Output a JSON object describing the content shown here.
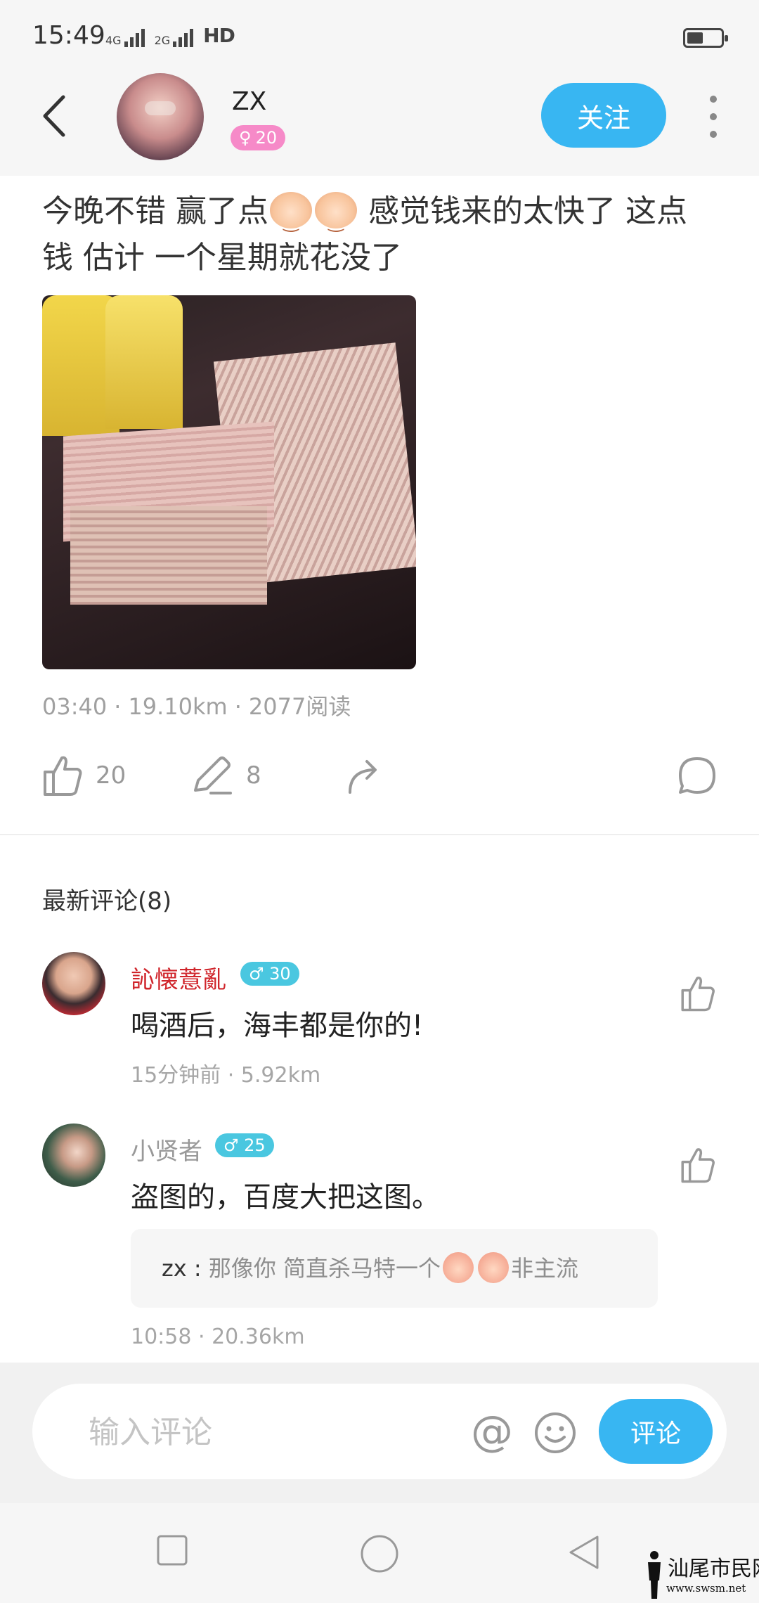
{
  "status_bar": {
    "time": "15:49",
    "network_1": "4G",
    "network_2": "2G",
    "hd": "HD"
  },
  "header": {
    "user_name": "ZX",
    "gender_symbol": "♀",
    "age": "20",
    "follow_label": "关注"
  },
  "post": {
    "text_part1": "今晚不错 赢了点",
    "text_part2": " 感觉钱来的太快了 这点钱 估计 一个星期就花没了",
    "time": "03:40",
    "distance": "19.10km",
    "reads": "2077阅读",
    "likes": "20",
    "comments": "8"
  },
  "comments_section": {
    "title": "最新评论(8)",
    "items": [
      {
        "name": "訫懐薏亂",
        "gender_symbol": "♂",
        "age": "30",
        "text": "喝酒后，海丰都是你的!",
        "meta": "15分钟前 · 5.92km"
      },
      {
        "name": "小贤者",
        "gender_symbol": "♂",
        "age": "25",
        "text": "盗图的，百度大把这图。",
        "reply_user": "zx : ",
        "reply_text": "那像你 简直杀马特一个",
        "reply_suffix": "非主流",
        "meta": "10:58 · 20.36km"
      }
    ]
  },
  "input_bar": {
    "placeholder": "输入评论",
    "at_symbol": "@",
    "submit_label": "评论"
  },
  "watermark": {
    "text": "汕尾市民网",
    "url": "www.swsm.net"
  },
  "colors": {
    "accent": "#38b6f2",
    "female_badge": "#f68ac8",
    "male_badge": "#4ac7e0",
    "vip_name": "#d0252b"
  }
}
